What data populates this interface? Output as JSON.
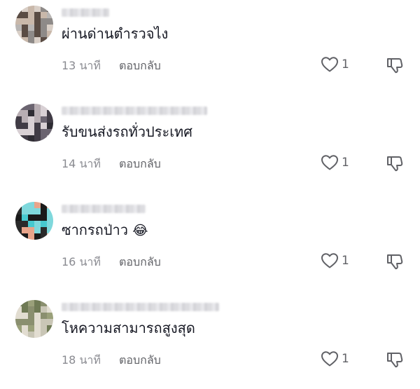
{
  "comments": [
    {
      "username_hidden": true,
      "text": "ผ่านด่านตำรวจไง",
      "time": "13 นาที",
      "reply_label": "ตอบกลับ",
      "likes": "1",
      "avatar_colors": [
        "#b9b6b4",
        "#8e8a88",
        "#d9cfc7",
        "#5a4c44",
        "#c9b8aa"
      ]
    },
    {
      "username_hidden": true,
      "text": "รับขนส่งรถทั่วประเทศ",
      "time": "14 นาที",
      "reply_label": "ตอบกลับ",
      "likes": "1",
      "avatar_colors": [
        "#2e2c33",
        "#6b6470",
        "#b8aeb3",
        "#403b45",
        "#d8d0d4"
      ]
    },
    {
      "username_hidden": true,
      "text": "ซากรถป่าว",
      "emoji": "😂",
      "time": "16 นาที",
      "reply_label": "ตอบกลับ",
      "likes": "1",
      "avatar_colors": [
        "#47c9cf",
        "#2a2a2a",
        "#e8a48a",
        "#7fd8dc",
        "#1a1a1a"
      ]
    },
    {
      "username_hidden": true,
      "text": "โหความสามารถสูงสุด",
      "time": "18 นาที",
      "reply_label": "ตอบกลับ",
      "likes": "1",
      "avatar_colors": [
        "#9aa07a",
        "#c9c6b6",
        "#6f7a55",
        "#e2ddd1",
        "#8a8f6f"
      ]
    }
  ],
  "colors": {
    "text": "#161823",
    "meta": "#8a8b91",
    "icon": "#606166"
  }
}
